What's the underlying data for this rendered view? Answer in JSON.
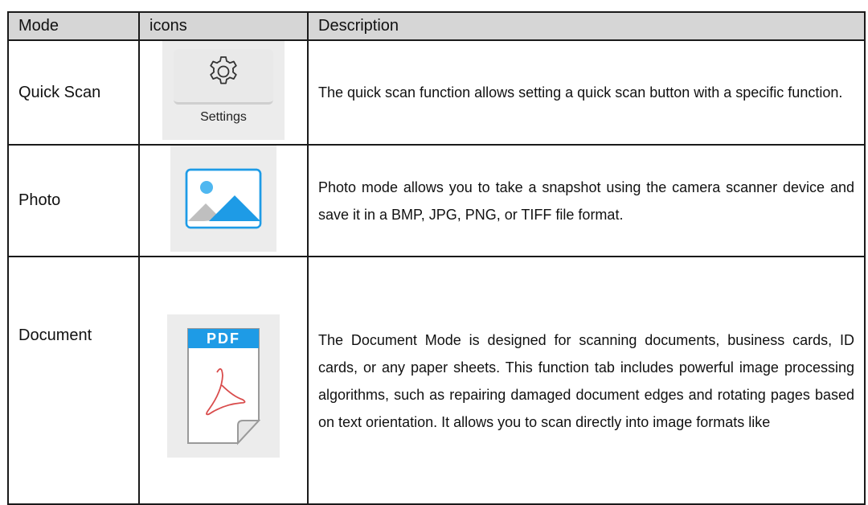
{
  "header": {
    "mode": "Mode",
    "icons": "icons",
    "description": "Description"
  },
  "rows": [
    {
      "mode": "Quick Scan",
      "icon": "gear-icon",
      "icon_caption": "Settings",
      "description": "The quick scan function allows setting a quick scan button with a specific function."
    },
    {
      "mode": "Photo",
      "icon": "picture-icon",
      "description": "Photo mode allows you to take a snapshot using the camera scanner device and save it in a BMP, JPG, PNG, or TIFF file format."
    },
    {
      "mode": "Document",
      "icon": "pdf-file-icon",
      "icon_label": "PDF",
      "description": "The Document Mode is designed for scanning documents, business cards, ID cards, or any paper sheets. This function tab includes powerful image processing algorithms, such as repairing damaged document edges and rotating pages based on text orientation. It allows you to scan directly into image formats like"
    }
  ],
  "colors": {
    "header_bg": "#d6d6d6",
    "tile_bg": "#ececec",
    "photo_blue": "#1e9be6",
    "pdf_blue": "#1e9be6"
  }
}
